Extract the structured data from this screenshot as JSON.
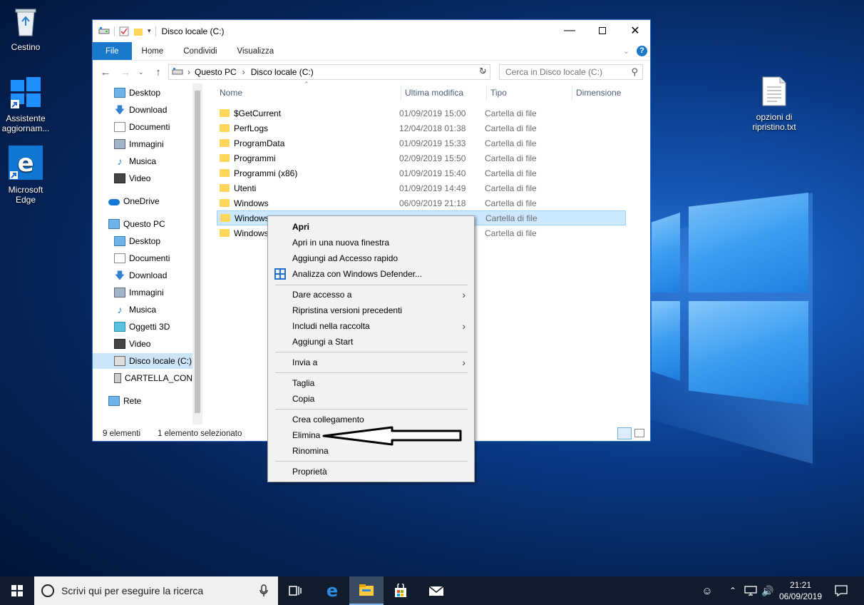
{
  "desktop": {
    "icons": [
      {
        "label": "Cestino"
      },
      {
        "label": "Assistente aggiornam..."
      },
      {
        "label": "Microsoft Edge"
      },
      {
        "label": "opzioni di ripristino.txt"
      }
    ]
  },
  "window": {
    "title": "Disco locale (C:)",
    "ribbon_tabs": [
      "File",
      "Home",
      "Condividi",
      "Visualizza"
    ],
    "breadcrumb": [
      "Questo PC",
      "Disco locale (C:)"
    ],
    "search_placeholder": "Cerca in Disco locale (C:)",
    "nav_pane": [
      {
        "label": "Desktop",
        "icon": "desktop-icon",
        "pinned": true
      },
      {
        "label": "Download",
        "icon": "download-icon",
        "pinned": true
      },
      {
        "label": "Documenti",
        "icon": "documents-icon",
        "pinned": true
      },
      {
        "label": "Immagini",
        "icon": "pictures-icon",
        "pinned": true
      },
      {
        "label": "Musica",
        "icon": "music-icon"
      },
      {
        "label": "Video",
        "icon": "video-icon"
      },
      {
        "label": "OneDrive",
        "icon": "onedrive-icon"
      },
      {
        "label": "Questo PC",
        "icon": "pc-icon"
      },
      {
        "label": "Desktop",
        "icon": "desktop-icon"
      },
      {
        "label": "Documenti",
        "icon": "documents-icon"
      },
      {
        "label": "Download",
        "icon": "download-icon"
      },
      {
        "label": "Immagini",
        "icon": "pictures-icon"
      },
      {
        "label": "Musica",
        "icon": "music-icon"
      },
      {
        "label": "Oggetti 3D",
        "icon": "3d-objects-icon"
      },
      {
        "label": "Video",
        "icon": "video-icon"
      },
      {
        "label": "Disco locale (C:)",
        "icon": "drive-icon",
        "selected": true
      },
      {
        "label": "CARTELLA_CON",
        "icon": "network-drive-icon"
      },
      {
        "label": "Rete",
        "icon": "network-icon"
      }
    ],
    "columns": [
      "Nome",
      "Ultima modifica",
      "Tipo",
      "Dimensione"
    ],
    "files": [
      {
        "name": "$GetCurrent",
        "date": "01/09/2019 15:00",
        "type": "Cartella di file"
      },
      {
        "name": "PerfLogs",
        "date": "12/04/2018 01:38",
        "type": "Cartella di file"
      },
      {
        "name": "ProgramData",
        "date": "01/09/2019 15:33",
        "type": "Cartella di file"
      },
      {
        "name": "Programmi",
        "date": "02/09/2019 15:50",
        "type": "Cartella di file"
      },
      {
        "name": "Programmi (x86)",
        "date": "01/09/2019 15:40",
        "type": "Cartella di file"
      },
      {
        "name": "Utenti",
        "date": "01/09/2019 14:49",
        "type": "Cartella di file"
      },
      {
        "name": "Windows",
        "date": "06/09/2019 21:18",
        "type": "Cartella di file"
      },
      {
        "name": "Windows",
        "date": "",
        "type": "Cartella di file",
        "selected": true
      },
      {
        "name": "Windows",
        "date": "",
        "type": "Cartella di file"
      }
    ],
    "status": {
      "count": "9 elementi",
      "selection": "1 elemento selezionato"
    }
  },
  "context_menu": {
    "items": [
      {
        "label": "Apri",
        "bold": true
      },
      {
        "label": "Apri in una nuova finestra"
      },
      {
        "label": "Aggiungi ad Accesso rapido"
      },
      {
        "label": "Analizza con Windows Defender...",
        "icon": "defender-icon"
      },
      {
        "label": "Dare accesso a",
        "submenu": true
      },
      {
        "label": "Ripristina versioni precedenti"
      },
      {
        "label": "Includi nella raccolta",
        "submenu": true
      },
      {
        "label": "Aggiungi a Start"
      },
      {
        "label": "Invia a",
        "submenu": true
      },
      {
        "label": "Taglia"
      },
      {
        "label": "Copia"
      },
      {
        "label": "Crea collegamento"
      },
      {
        "label": "Elimina",
        "highlighted_by_arrow": true
      },
      {
        "label": "Rinomina"
      },
      {
        "label": "Proprietà"
      }
    ]
  },
  "taskbar": {
    "search_placeholder": "Scrivi qui per eseguire la ricerca",
    "time": "21:21",
    "date": "06/09/2019"
  },
  "colors": {
    "accent": "#1979ca",
    "selection": "#cce8ff",
    "folder": "#ffd65c",
    "taskbar": "#101b2b"
  }
}
